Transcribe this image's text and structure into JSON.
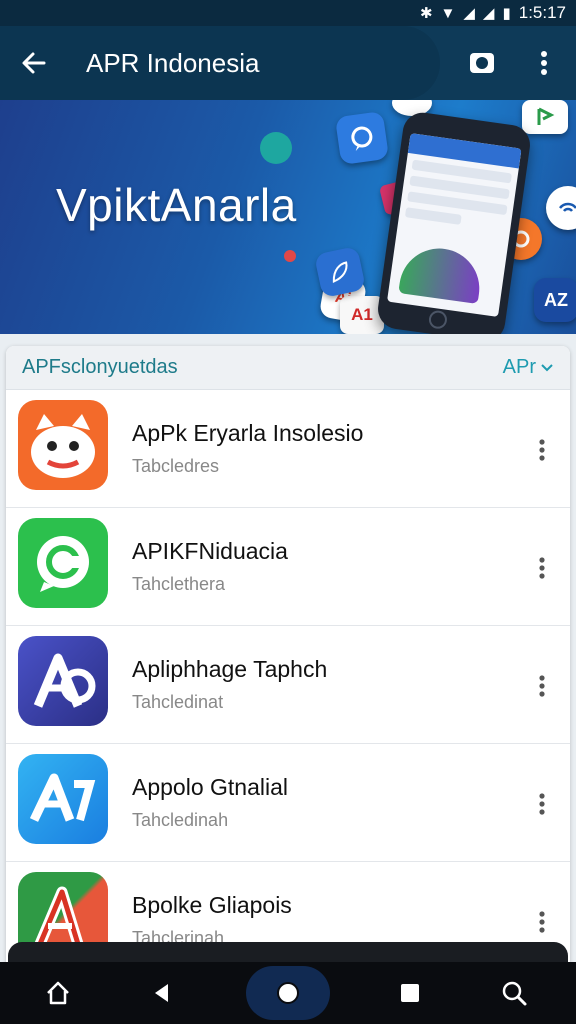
{
  "status_bar": {
    "time": "1:5:17"
  },
  "app_bar": {
    "title": "APR Indonesia"
  },
  "banner": {
    "title": "VpiktAnarla",
    "icon_labels": [
      "Ai",
      "A1",
      "AZ"
    ]
  },
  "list": {
    "section_title": "APFsclonyuetdas",
    "filter_label": "APr",
    "items": [
      {
        "name": "ApPk Eryarla Insolesio",
        "subtitle": "Tabcledres",
        "icon": "cat-app-icon",
        "color": "#f36a2a"
      },
      {
        "name": "APIKFNiduacia",
        "subtitle": "Tahclethera",
        "icon": "chat-app-icon",
        "color": "#2cc04d"
      },
      {
        "name": "Apliphhage Taphch",
        "subtitle": "Tahcledinat",
        "icon": "a-logo-app-icon",
        "color": "#3c3fa0"
      },
      {
        "name": "Appolo Gtnalial",
        "subtitle": "Tahcledinah",
        "icon": "a-blue-app-icon",
        "color": "#2a8ee8"
      },
      {
        "name": "Bpolke Gliapois",
        "subtitle": "Tahclerinah",
        "icon": "a-red-app-icon",
        "color": "#2e8a3a"
      }
    ]
  },
  "colors": {
    "primary": "#0e3a58",
    "accent": "#1e9bb0",
    "nav": "#0a0c10"
  }
}
